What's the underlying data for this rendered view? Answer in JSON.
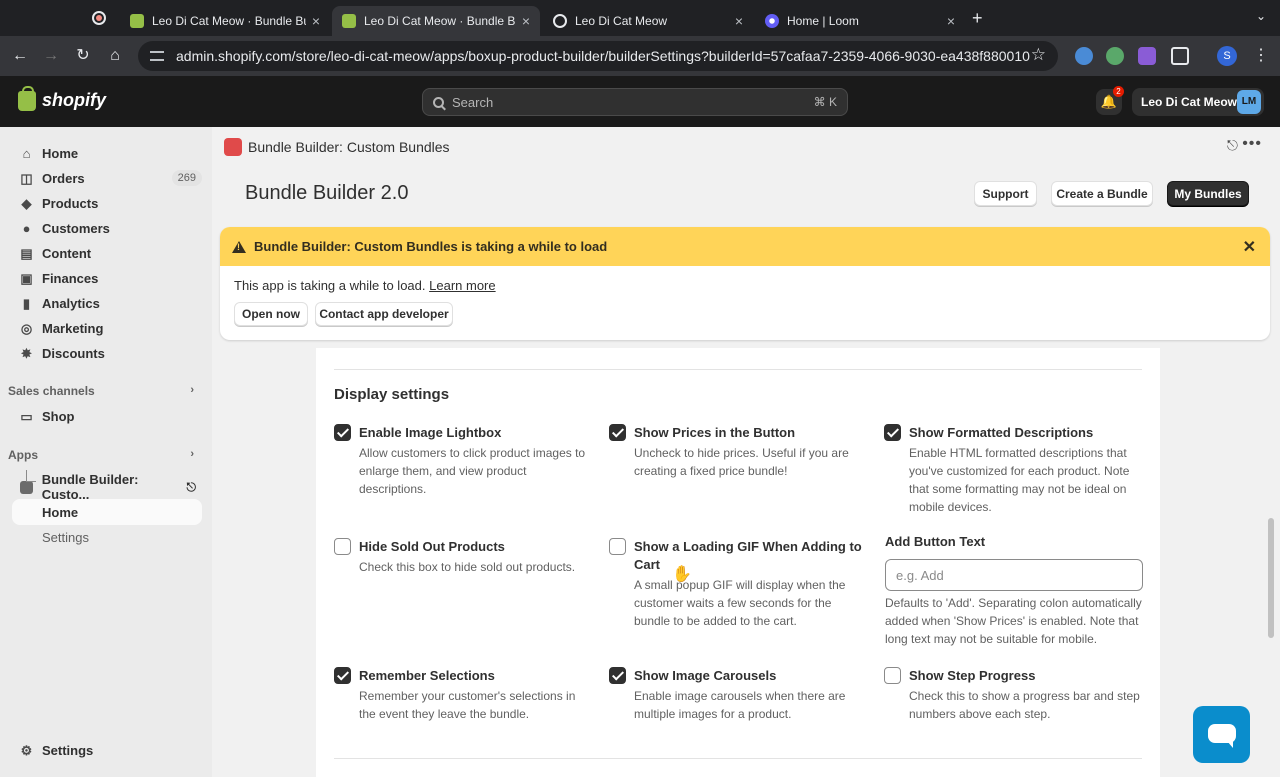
{
  "browser": {
    "tabs": [
      {
        "title": "Leo Di Cat Meow · Bundle Bui",
        "favicon": "shopify-icon",
        "active": false
      },
      {
        "title": "Leo Di Cat Meow · Bundle Bui",
        "favicon": "shopify-icon",
        "active": true
      },
      {
        "title": "Leo Di Cat Meow",
        "favicon": "globe-icon",
        "active": false
      },
      {
        "title": "Home | Loom",
        "favicon": "loom-icon",
        "active": false
      }
    ],
    "close_glyph": "×",
    "new_tab_glyph": "+",
    "url": "admin.shopify.com/store/leo-di-cat-meow/apps/boxup-product-builder/builderSettings?builderId=57cafaa7-2359-4066-9030-ea438f880010",
    "profile_initial": "S"
  },
  "shopify": {
    "logo_text": "shopify",
    "search_placeholder": "Search",
    "search_shortcut": "⌘ K",
    "notification_count": "2",
    "store_name": "Leo Di Cat Meow",
    "store_initials": "LM"
  },
  "sidebar": {
    "items": [
      {
        "label": "Home",
        "icon": "home-icon"
      },
      {
        "label": "Orders",
        "icon": "orders-icon",
        "badge": "269"
      },
      {
        "label": "Products",
        "icon": "tag-icon"
      },
      {
        "label": "Customers",
        "icon": "person-icon"
      },
      {
        "label": "Content",
        "icon": "content-icon"
      },
      {
        "label": "Finances",
        "icon": "bank-icon"
      },
      {
        "label": "Analytics",
        "icon": "chart-icon"
      },
      {
        "label": "Marketing",
        "icon": "target-icon"
      },
      {
        "label": "Discounts",
        "icon": "discount-icon"
      }
    ],
    "sales_channels_title": "Sales channels",
    "shop_label": "Shop",
    "apps_title": "Apps",
    "app_name": "Bundle Builder: Custo...",
    "app_sub": [
      "Home",
      "Settings"
    ],
    "settings_label": "Settings"
  },
  "app_header": {
    "title": "Bundle Builder: Custom Bundles"
  },
  "page": {
    "title": "Bundle Builder 2.0",
    "buttons": {
      "support": "Support",
      "create": "Create a Bundle",
      "my_bundles": "My Bundles"
    }
  },
  "banner": {
    "title": "Bundle Builder: Custom Bundles is taking a while to load",
    "message": "This app is taking a while to load.",
    "link": "Learn more",
    "open_now": "Open now",
    "contact": "Contact app developer"
  },
  "display_settings": {
    "title": "Display settings",
    "options": [
      {
        "label": "Enable Image Lightbox",
        "checked": true,
        "desc": "Allow customers to click product images to enlarge them, and view product descriptions."
      },
      {
        "label": "Show Prices in the Button",
        "checked": true,
        "desc": "Uncheck to hide prices. Useful if you are creating a fixed price bundle!"
      },
      {
        "label": "Show Formatted Descriptions",
        "checked": true,
        "desc": "Enable HTML formatted descriptions that you've customized for each product. Note that some formatting may not be ideal on mobile devices."
      },
      {
        "label": "Hide Sold Out Products",
        "checked": false,
        "desc": "Check this box to hide sold out products."
      },
      {
        "label": "Show a Loading GIF When Adding to Cart",
        "checked": false,
        "desc": "A small popup GIF will display when the customer waits a few seconds for the bundle to be added to the cart."
      },
      {
        "label": "Remember Selections",
        "checked": true,
        "desc": "Remember your customer's selections in the event they leave the bundle."
      },
      {
        "label": "Show Image Carousels",
        "checked": true,
        "desc": "Enable image carousels when there are multiple images for a product."
      },
      {
        "label": "Show Step Progress",
        "checked": false,
        "desc": "Check this to show a progress bar and step numbers above each step."
      }
    ],
    "add_button_text": {
      "label": "Add Button Text",
      "placeholder": "e.g. Add",
      "value": "",
      "help": "Defaults to 'Add'. Separating colon automatically added when 'Show Prices' is enabled. Note that long text may not be suitable for mobile."
    }
  },
  "colors": {
    "warning_banner": "#ffd458",
    "topbar": "#1a1a1a",
    "chat_button": "#0a8dcc"
  }
}
